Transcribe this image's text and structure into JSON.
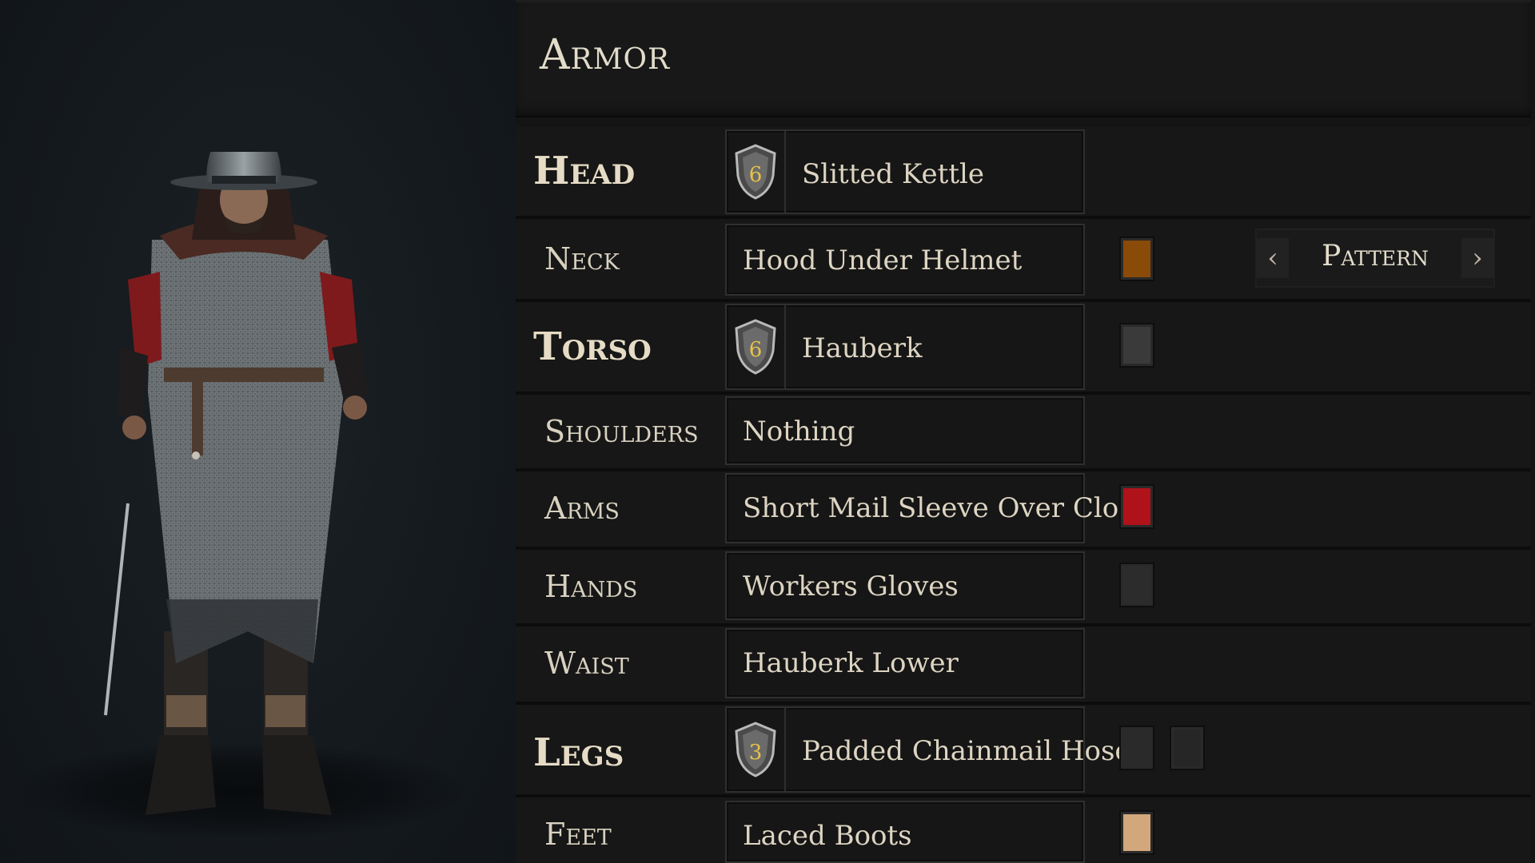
{
  "panel": {
    "title": "Armor"
  },
  "slots": [
    {
      "label": "Head",
      "item": "Slitted Kettle",
      "tier": "6"
    },
    {
      "label": "Neck",
      "item": "Hood Under Helmet",
      "pattern_label": "Pattern",
      "prev": "‹",
      "next": "›"
    },
    {
      "label": "Torso",
      "item": "Hauberk",
      "tier": "6"
    },
    {
      "label": "Shoulders",
      "item": "Nothing"
    },
    {
      "label": "Arms",
      "item": "Short Mail Sleeve Over Cloth"
    },
    {
      "label": "Hands",
      "item": "Workers Gloves"
    },
    {
      "label": "Waist",
      "item": "Hauberk Lower"
    },
    {
      "label": "Legs",
      "item": "Padded Chainmail Hosen",
      "tier": "3"
    },
    {
      "label": "Feet",
      "item": "Laced Boots"
    }
  ],
  "colors": {
    "neck_swatch": "#8a4a08",
    "torso_swatch": "#3a3a3a",
    "arms_swatch": "#b0121a",
    "hands_swatch": "#2c2c2c",
    "legs_swatch_1": "#2a2a2a",
    "legs_swatch_2": "#262626",
    "feet_swatch": "#d2a77c"
  },
  "icons": {
    "tier_badge": "shield-icon"
  }
}
